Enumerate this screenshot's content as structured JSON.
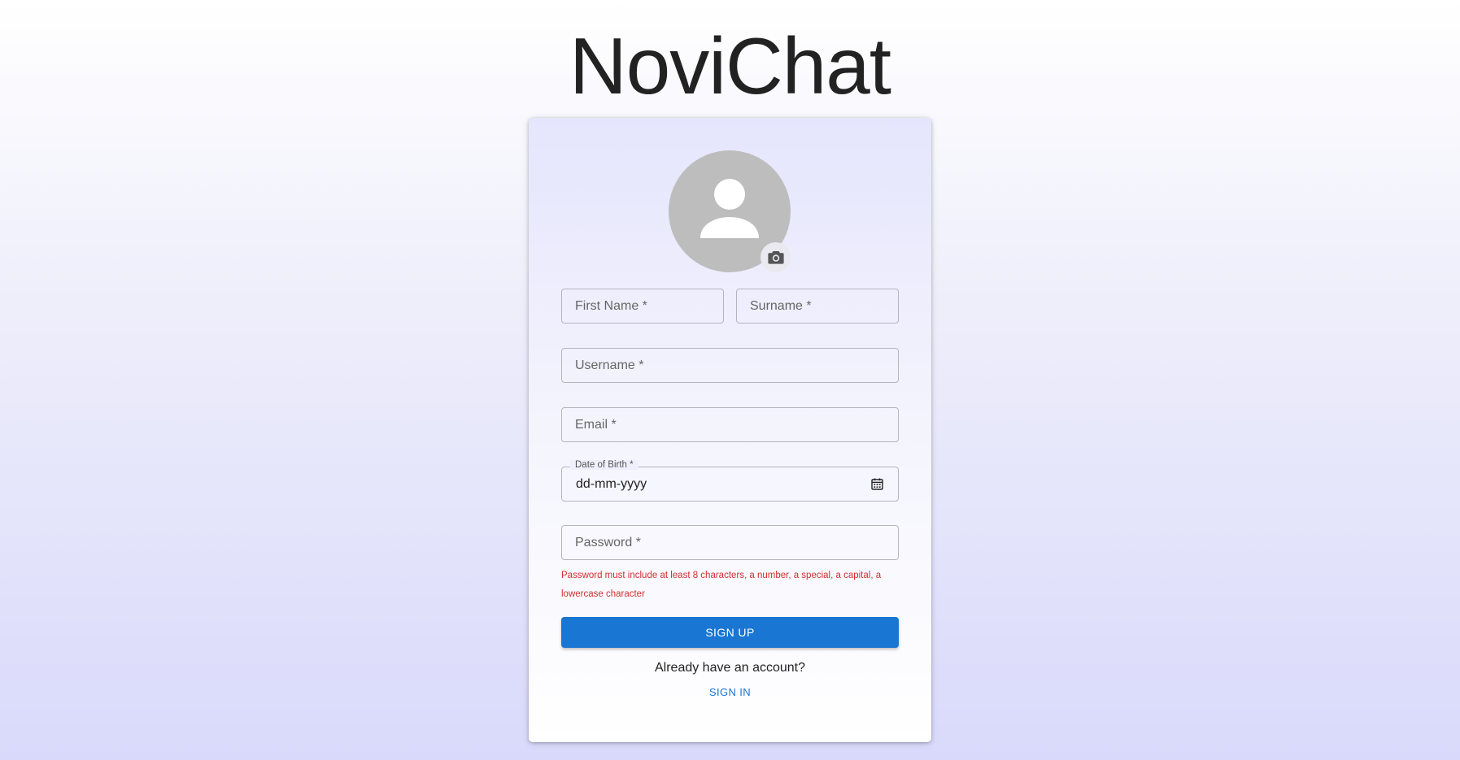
{
  "app": {
    "title": "NoviChat"
  },
  "form": {
    "first_name_label": "First Name *",
    "surname_label": "Surname *",
    "username_label": "Username *",
    "email_label": "Email *",
    "dob_label": "Date of Birth *",
    "dob_placeholder": "dd-mm-yyyy",
    "password_label": "Password *",
    "password_helper": "Password must include at least 8 characters, a number, a special, a capital, a lowercase character"
  },
  "actions": {
    "signup_label": "SIGN UP",
    "already_text": "Already have an account?",
    "signin_label": "SIGN IN"
  },
  "icons": {
    "avatar": "person-icon",
    "upload": "camera-icon",
    "calendar": "calendar-icon"
  },
  "colors": {
    "primary": "#1976d2",
    "error": "#d32f2f",
    "avatar_bg": "#bdbdbd"
  }
}
